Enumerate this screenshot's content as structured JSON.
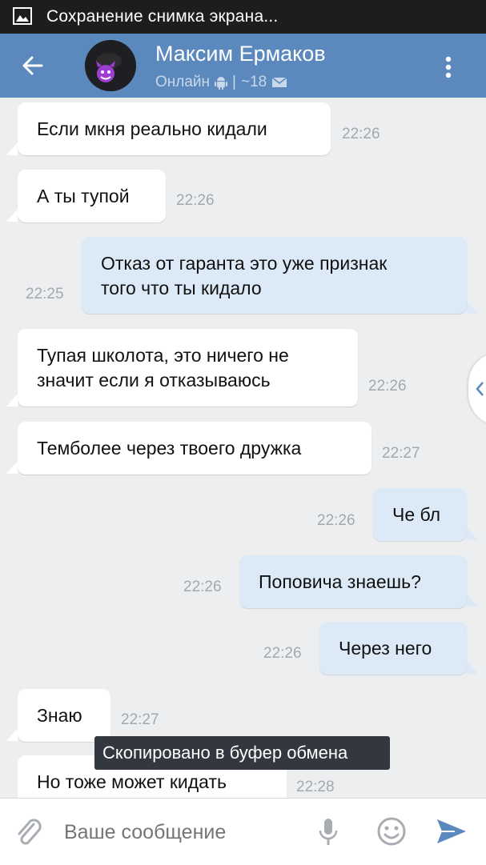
{
  "statusbar": {
    "notification_text": "Сохранение снимка экрана..."
  },
  "header": {
    "contact_name": "Максим Ермаков",
    "status_online": "Онлайн",
    "separator": "|",
    "message_count": "~18"
  },
  "messages": [
    {
      "direction": "in",
      "text": "Если мкня реально кидали",
      "time": "22:26"
    },
    {
      "direction": "in",
      "text": "А ты тупой",
      "time": "22:26"
    },
    {
      "direction": "out",
      "text": "Отказ от гаранта это уже признак\nтого что ты кидало",
      "time": "22:25"
    },
    {
      "direction": "in",
      "text": "Тупая школота, это ничего не\nзначит если я отказываюсь",
      "time": "22:26"
    },
    {
      "direction": "in",
      "text": "Темболее через твоего дружка",
      "time": "22:27"
    },
    {
      "direction": "out",
      "text": "Че бл",
      "time": "22:26"
    },
    {
      "direction": "out",
      "text": "Поповича знаешь?",
      "time": "22:26"
    },
    {
      "direction": "out",
      "text": "Через него",
      "time": "22:26"
    },
    {
      "direction": "in",
      "text": "Знаю",
      "time": "22:27"
    },
    {
      "direction": "in",
      "text": "Но тоже может кидать",
      "time": "22:28"
    }
  ],
  "toast": {
    "text": "Скопировано в буфер обмена"
  },
  "composer": {
    "placeholder": "Ваше сообщение"
  },
  "icons": {
    "back": "back-arrow-icon",
    "more": "more-vertical-icon",
    "attach": "paperclip-icon",
    "mic": "microphone-icon",
    "emoji": "smiley-icon",
    "send": "send-icon",
    "android": "android-icon",
    "mail": "envelope-icon",
    "side": "chevron-left-icon"
  },
  "colors": {
    "header": "#5b88bd",
    "outgoing_bubble": "#dce9f6",
    "incoming_bubble": "#ffffff",
    "background": "#edeef0",
    "send": "#5b88bd"
  }
}
